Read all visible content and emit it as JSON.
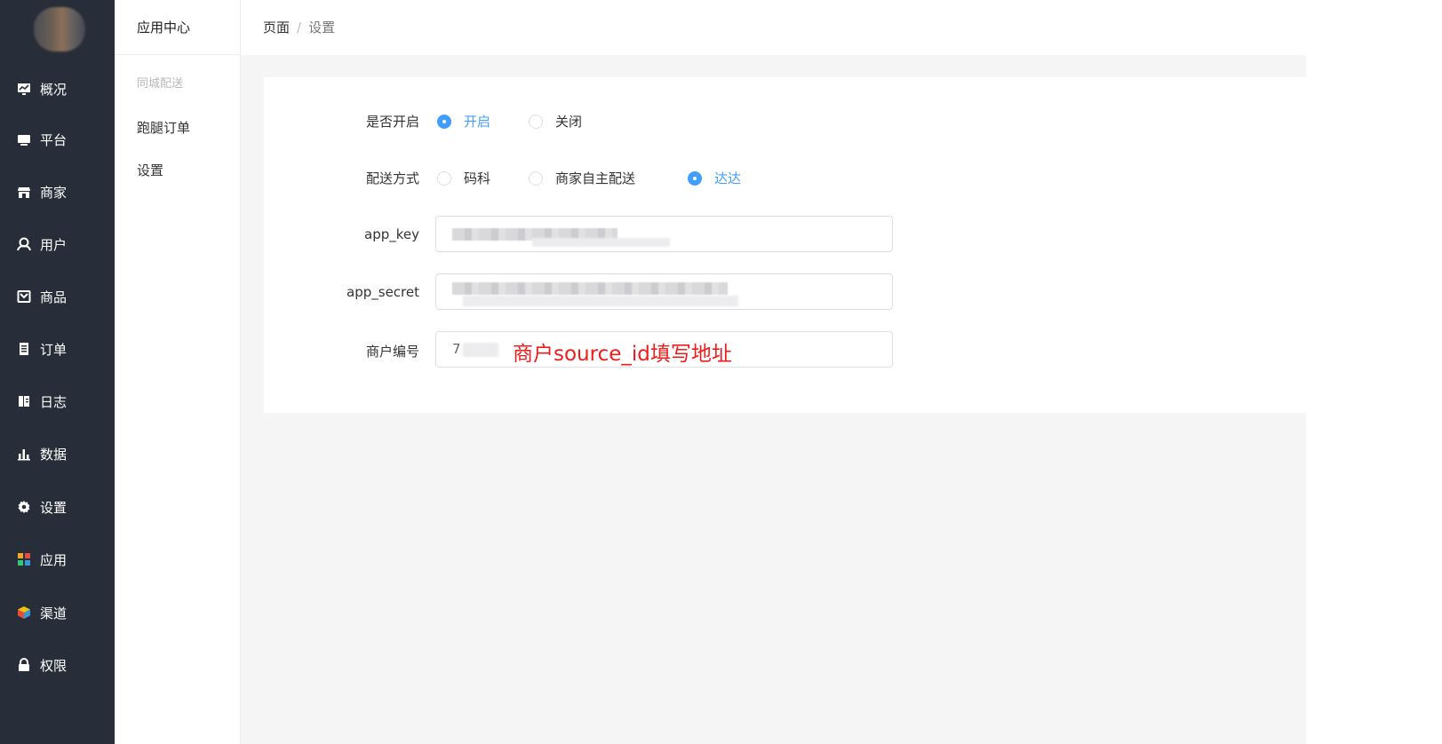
{
  "sidebar": {
    "items": [
      {
        "label": "概况",
        "icon": "overview-chart-icon"
      },
      {
        "label": "平台",
        "icon": "monitor-icon"
      },
      {
        "label": "商家",
        "icon": "store-icon"
      },
      {
        "label": "用户",
        "icon": "user-icon"
      },
      {
        "label": "商品",
        "icon": "product-box-icon"
      },
      {
        "label": "订单",
        "icon": "order-list-icon"
      },
      {
        "label": "日志",
        "icon": "log-book-icon"
      },
      {
        "label": "数据",
        "icon": "bar-chart-icon"
      },
      {
        "label": "设置",
        "icon": "gear-icon"
      },
      {
        "label": "应用",
        "icon": "apps-grid-icon"
      },
      {
        "label": "渠道",
        "icon": "channel-cube-icon"
      },
      {
        "label": "权限",
        "icon": "lock-icon"
      }
    ]
  },
  "submenu": {
    "title": "应用中心",
    "group": "同城配送",
    "items": [
      "跑腿订单",
      "设置"
    ]
  },
  "breadcrumb": {
    "root": "页面",
    "separator": "/",
    "current": "设置"
  },
  "form": {
    "enable": {
      "label": "是否开启",
      "options": [
        "开启",
        "关闭"
      ],
      "selected": "开启"
    },
    "delivery": {
      "label": "配送方式",
      "options": [
        "码科",
        "商家自主配送",
        "达达"
      ],
      "selected": "达达"
    },
    "app_key": {
      "label": "app_key"
    },
    "app_secret": {
      "label": "app_secret"
    },
    "merchant_no": {
      "label": "商户编号",
      "value_visible": "7",
      "annotation": "商户source_id填写地址"
    }
  },
  "colors": {
    "sidebar_bg": "#282e39",
    "primary": "#409eff",
    "annotation": "#ef1c1c",
    "main_bg": "#f5f5f5"
  }
}
